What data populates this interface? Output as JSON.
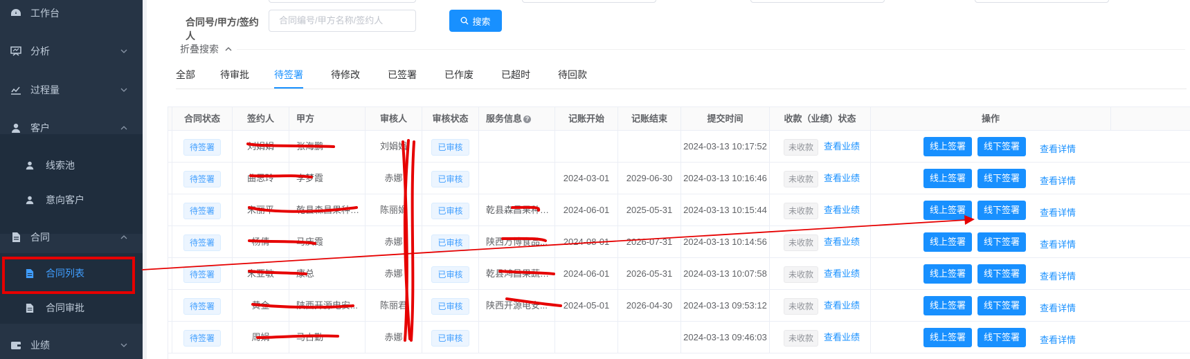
{
  "sidebar": {
    "items": [
      {
        "label": "工作台",
        "icon": "dashboard-icon"
      },
      {
        "label": "分析",
        "icon": "chart-icon"
      },
      {
        "label": "过程量",
        "icon": "trend-icon"
      },
      {
        "label": "客户",
        "icon": "user-icon"
      },
      {
        "label": "线索池",
        "icon": "user-icon"
      },
      {
        "label": "意向客户",
        "icon": "user-icon"
      },
      {
        "label": "合同",
        "icon": "document-icon"
      },
      {
        "label": "合同列表",
        "icon": "document-icon"
      },
      {
        "label": "合同审批",
        "icon": "document-icon"
      },
      {
        "label": "业绩",
        "icon": "wallet-icon"
      }
    ]
  },
  "search": {
    "label": "合同号/甲方/签约人",
    "placeholder": "合同编号/甲方名称/签约人",
    "button": "搜索",
    "collapse": "折叠搜索"
  },
  "tabs": [
    "全部",
    "待审批",
    "待签署",
    "待修改",
    "已签署",
    "已作废",
    "已超时",
    "待回款"
  ],
  "table": {
    "headers": [
      "合同状态",
      "签约人",
      "甲方",
      "审核人",
      "审核状态",
      "服务信息",
      "记账开始",
      "记账结束",
      "提交时间",
      "收款（业绩）状态",
      "操作"
    ],
    "rows": [
      {
        "status": "待签署",
        "signer": "刘娟娟",
        "party": "张海鹏",
        "auditor": "刘娟娟",
        "audit": "已审核",
        "service": "",
        "start": "",
        "end": "",
        "submitted": "2024-03-13 10:17:52",
        "pay": "未收款"
      },
      {
        "status": "待签署",
        "signer": "曲思玲",
        "party": "李梦霞",
        "auditor": "赤娜",
        "audit": "已审核",
        "service": "",
        "start": "2024-03-01",
        "end": "2029-06-30",
        "submitted": "2024-03-13 10:16:46",
        "pay": "未收款"
      },
      {
        "status": "待签署",
        "signer": "宋丽平",
        "party": "乾县森昌果种植...",
        "auditor": "陈丽娟",
        "audit": "已审核",
        "service": "乾县森昌果种植...",
        "start": "2024-06-01",
        "end": "2025-05-31",
        "submitted": "2024-03-13 10:15:44",
        "pay": "未收款"
      },
      {
        "status": "待签署",
        "signer": "杨倩",
        "party": "马庆霞",
        "auditor": "赤娜",
        "audit": "已审核",
        "service": "陕西万博食品...",
        "start": "2024-08-01",
        "end": "2026-07-31",
        "submitted": "2024-03-13 10:14:56",
        "pay": "未收款"
      },
      {
        "status": "待签署",
        "signer": "宋亚敏",
        "party": "康总",
        "auditor": "赤娜",
        "audit": "已审核",
        "service": "乾县鸿昌果蔬专...",
        "start": "2024-06-01",
        "end": "2026-05-31",
        "submitted": "2024-03-13 10:07:58",
        "pay": "未收款"
      },
      {
        "status": "待签署",
        "signer": "黄金",
        "party": "陕西开源电安...",
        "auditor": "陈丽君",
        "audit": "已审核",
        "service": "陕西开源电安...",
        "start": "2024-05-01",
        "end": "2026-04-30",
        "submitted": "2024-03-13 09:53:12",
        "pay": "未收款"
      },
      {
        "status": "待签署",
        "signer": "周娟",
        "party": "马占勤",
        "auditor": "赤娜",
        "audit": "已审核",
        "service": "",
        "start": "",
        "end": "",
        "submitted": "2024-03-13 09:46:03",
        "pay": "未收款"
      }
    ],
    "view_performance": "查看业绩",
    "online_sign": "线上签署",
    "offline_sign": "线下签署",
    "view_detail": "查看详情"
  },
  "colors": {
    "sidebar": "#263445",
    "accent": "#1890ff",
    "annotation": "#e60000"
  }
}
